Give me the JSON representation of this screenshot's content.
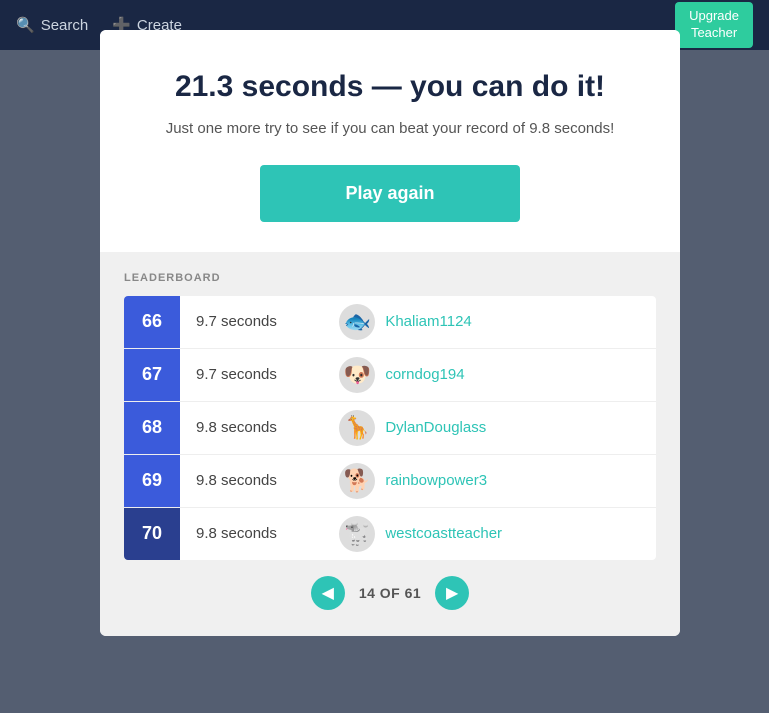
{
  "nav": {
    "search_label": "Search",
    "create_label": "Create",
    "upgrade_label": "Upgrade\nTeacher"
  },
  "modal": {
    "title": "21.3 seconds — you can do it!",
    "subtitle": "Just one more try to see if you can beat your record of 9.8 seconds!",
    "play_again_label": "Play again"
  },
  "leaderboard": {
    "section_label": "LEADERBOARD",
    "rows": [
      {
        "rank": "66",
        "time": "9.7 seconds",
        "avatar": "🐟",
        "name": "Khaliam1124",
        "current": false
      },
      {
        "rank": "67",
        "time": "9.7 seconds",
        "avatar": "🐶",
        "name": "corndog194",
        "current": false
      },
      {
        "rank": "68",
        "time": "9.8 seconds",
        "avatar": "🦒",
        "name": "DylanDouglass",
        "current": false
      },
      {
        "rank": "69",
        "time": "9.8 seconds",
        "avatar": "🐕",
        "name": "rainbowpower3",
        "current": false
      },
      {
        "rank": "70",
        "time": "9.8 seconds",
        "avatar": "🐩",
        "name": "westcoastteacher",
        "current": true
      }
    ]
  },
  "pagination": {
    "current": "14",
    "total": "61",
    "display": "14 OF 61",
    "prev_label": "◀",
    "next_label": "▶"
  }
}
